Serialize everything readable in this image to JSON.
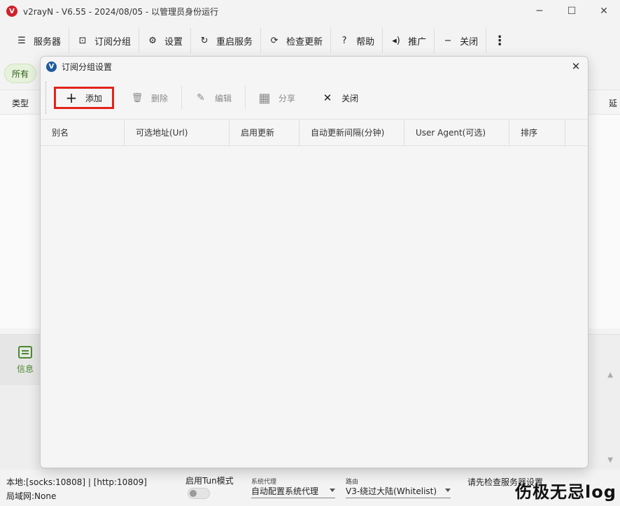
{
  "window": {
    "logo_text": "V",
    "title": "v2rayN - V6.55 - 2024/08/05 - 以管理员身份运行",
    "controls": {
      "minimize": "─",
      "maximize": "☐",
      "close": "✕"
    }
  },
  "toolbar": {
    "items": [
      {
        "label": "服务器",
        "icon": "server-icon",
        "glyph": "☰"
      },
      {
        "label": "订阅分组",
        "icon": "subscription-icon",
        "glyph": "⊡"
      },
      {
        "label": "设置",
        "icon": "gear-icon",
        "glyph": "⚙"
      },
      {
        "label": "重启服务",
        "icon": "restart-icon",
        "glyph": "↻"
      },
      {
        "label": "检查更新",
        "icon": "update-icon",
        "glyph": "⟳"
      },
      {
        "label": "帮助",
        "icon": "help-icon",
        "glyph": "?"
      },
      {
        "label": "推广",
        "icon": "speaker-icon",
        "glyph": "◂)"
      },
      {
        "label": "关闭",
        "icon": "minus-icon",
        "glyph": "−"
      }
    ],
    "more_glyph": "⋮"
  },
  "filter": {
    "all_label": "所有"
  },
  "server_list": {
    "col_type": "类型",
    "col_delay": "延"
  },
  "message_panel": {
    "tab_label": "信息",
    "scroll_up": "▲",
    "scroll_down": "▼"
  },
  "status": {
    "local_ports": "本地:[socks:10808] | [http:10809]",
    "lan": "局域网:None",
    "tun_label": "启用Tun模式",
    "tun_enabled": false,
    "sys_proxy_caption": "系统代理",
    "sys_proxy_value": "自动配置系统代理",
    "routing_caption": "路由",
    "routing_value": "V3-绕过大陆(Whitelist)",
    "server_hint": "请先检查服务器设置"
  },
  "watermark": "伤极无忌log",
  "dialog": {
    "logo_text": "V",
    "title": "订阅分组设置",
    "close_glyph": "✕",
    "toolbar": {
      "add": {
        "label": "添加",
        "glyph": "+"
      },
      "delete": {
        "label": "删除",
        "glyph": "🗑"
      },
      "edit": {
        "label": "编辑",
        "glyph": "✎"
      },
      "share": {
        "label": "分享",
        "glyph": "▦"
      },
      "close": {
        "label": "关闭",
        "glyph": "✕"
      }
    },
    "columns": [
      "别名",
      "可选地址(Url)",
      "启用更新",
      "自动更新间隔(分钟)",
      "User Agent(可选)",
      "排序"
    ],
    "rows": []
  },
  "colors": {
    "accent_red": "#e2231a",
    "logo_red": "#d0212c",
    "dialog_logo_blue": "#1e5a9e",
    "chip_green": "#2d5b18",
    "info_green": "#4a8a2f"
  }
}
